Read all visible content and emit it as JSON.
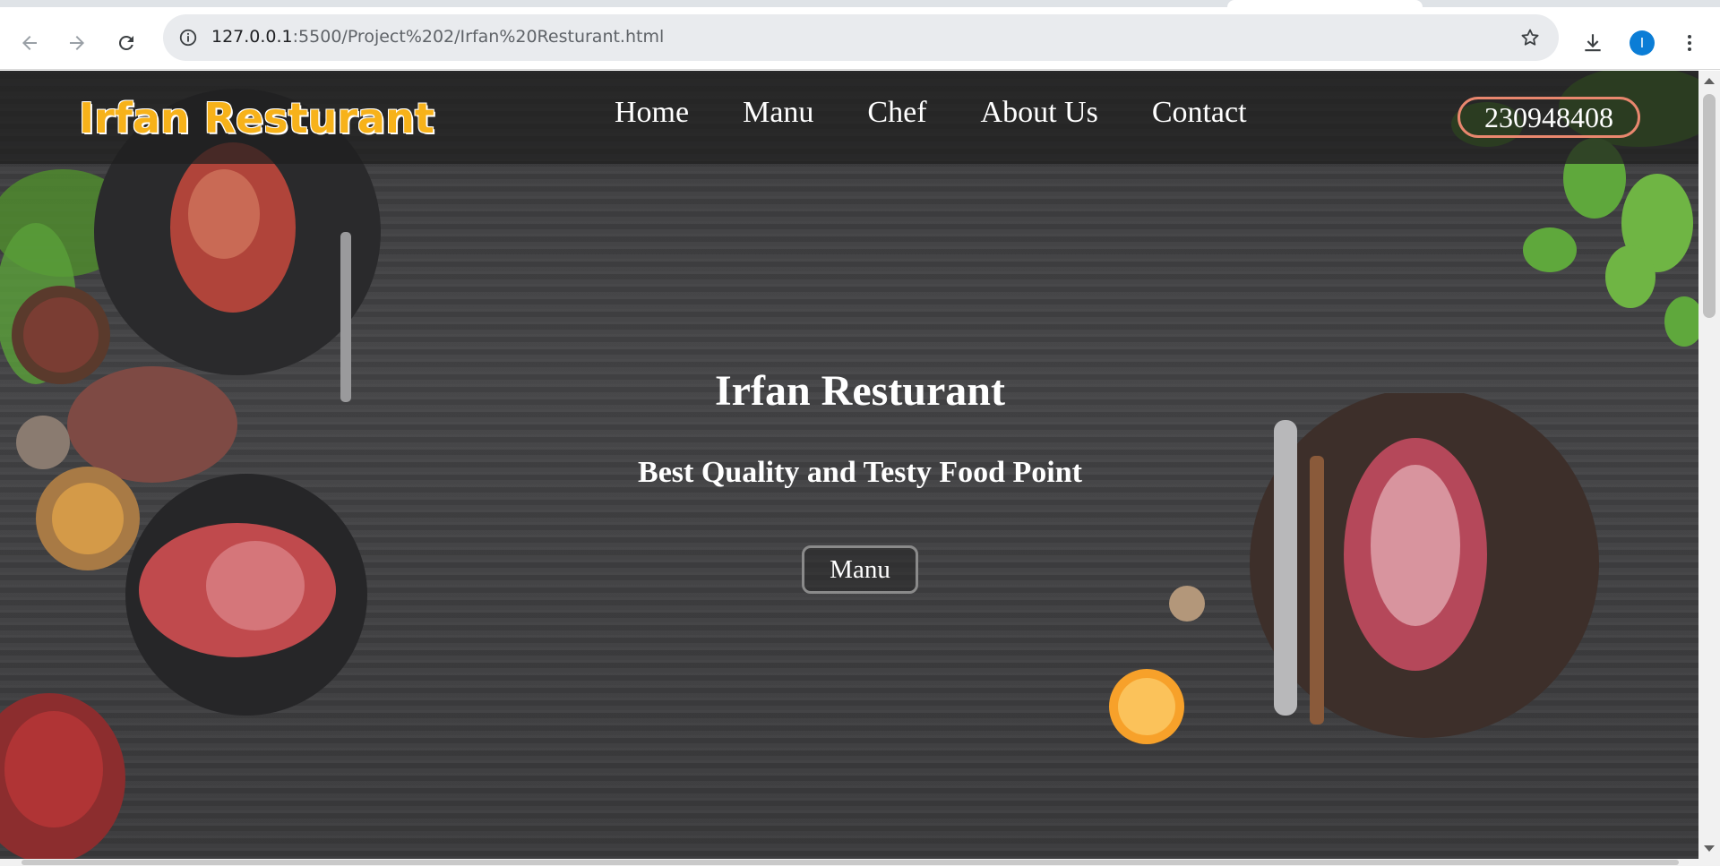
{
  "browser": {
    "url_host": "127.0.0.1",
    "url_path": ":5500/Project%202/Irfan%20Resturant.html",
    "profile_initial": "I",
    "icons": {
      "back": "back-arrow-icon",
      "forward": "forward-arrow-icon",
      "reload": "reload-icon",
      "site_info": "info-icon",
      "bookmark": "star-icon",
      "download": "download-icon",
      "menu": "kebab-menu-icon"
    },
    "colors": {
      "avatar": "#0b7dd6"
    }
  },
  "navbar": {
    "brand": "Irfan Resturant",
    "links": [
      "Home",
      "Manu",
      "Chef",
      "About Us",
      "Contact"
    ],
    "phone": "230948408"
  },
  "hero": {
    "title": "Irfan Resturant",
    "subtitle": "Best Quality and Testy Food Point",
    "button": "Manu"
  },
  "colors": {
    "brand": "#f7b21a",
    "phone_border": "#e9876e",
    "background": "#3a3a3c"
  }
}
